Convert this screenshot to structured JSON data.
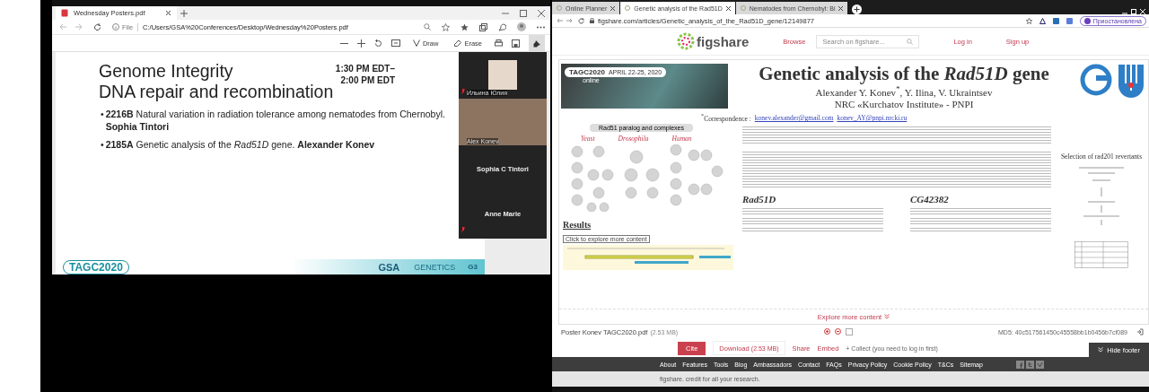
{
  "pdf_viewer": {
    "tab_title": "Wednesday Posters.pdf",
    "address_scheme": "File",
    "address": "C:/Users/GSA%20Conferences/Desktop/Wednesday%20Posters.pdf",
    "tools": [
      {
        "kind": "draw",
        "label": "Draw"
      },
      {
        "kind": "erase",
        "label": "Erase"
      }
    ]
  },
  "slide": {
    "title_lines": [
      "Genome Integrity",
      "DNA repair and recombination"
    ],
    "time_lines": [
      "1:30 PM EDT–",
      "2:00 PM EDT"
    ],
    "items": [
      {
        "marker": "•",
        "text": "**2216B** Natural variation in radiation tolerance among nematodes from Chernobyl. **Sophia Tintori**"
      },
      {
        "marker": "•",
        "text": "**2185A** Genetic analysis of the *Rad51D* gene. **Alexander Konev**"
      }
    ],
    "footer_logos": [
      "TAGC2020",
      "GSA",
      "GENETICS",
      "G3"
    ]
  },
  "video_gallery": [
    {
      "kind": "photo",
      "name": "Ильина Юлия",
      "muted": true
    },
    {
      "kind": "video",
      "name": "Alex Konev",
      "muted": false
    },
    {
      "kind": "name",
      "name": "Sophia C Tintori",
      "muted": false
    },
    {
      "kind": "name",
      "name": "Anne Marie",
      "muted": true
    }
  ],
  "browser": {
    "tabs": [
      {
        "title": "Online Planner",
        "selected": false
      },
      {
        "title": "Genetic analysis of the Rad51D",
        "selected": true
      },
      {
        "title": "Nematodes from Chernobyl: Bi",
        "selected": false
      }
    ],
    "address": "figshare.com/articles/Genetic_analysis_of_the_Rad51D_gene/12149877",
    "profile": "Приостановлена"
  },
  "figshare_header": {
    "logo": "figshare",
    "nav": "Browse",
    "search_placeholder": "Search on figshare...",
    "login": "Log in",
    "signup": "Sign up"
  },
  "poster": {
    "banner": {
      "name": "TAGC2020",
      "sub": "online",
      "dates": "APRIL 22-25, 2020"
    },
    "title": "Genetic analysis of the *Rad51D* gene",
    "authors": "Alexander Y.  Konev$^{*}$, Y. Ilina, V. Ukraintsev",
    "affiliation": "NRC «Kurchatov Institute» - PNPI",
    "correspondence_label": "$^{*}$Correspondence :",
    "emails": [
      "konev.alexander@gmail.com",
      "konev_AY@pnpi.nrcki.ru"
    ],
    "diagram_heading": "Rad51 paralog and complexes",
    "diagram_columns": [
      "Yeast",
      "Drosophila",
      "Human"
    ],
    "results_heading": "Results",
    "explore_hint": "Click to explore more content",
    "gene_headings": [
      "Rad51D",
      "CG42382"
    ],
    "side_heading": "Selection of rad201 revertants",
    "explore_more": "Explore more content"
  },
  "file_bar": {
    "file_name": "Poster Konev TAGC2020.pdf",
    "file_size": "(2.53 MB)",
    "md5": "MD5: 40c517561450c45558bb1b0456b7cf089"
  },
  "actions": {
    "cite": "Cite",
    "download": "Download",
    "download_size": "(2.53 MB)",
    "share": "Share",
    "embed": "Embed",
    "collect": "+ Collect (you need to log in first)",
    "hide_footer": "Hide footer"
  },
  "footer": {
    "links": [
      "About",
      "Features",
      "Tools",
      "Blog",
      "Ambassadors",
      "Contact",
      "FAQs",
      "Privacy Policy",
      "Cookie Policy",
      "T&Cs",
      "Sitemap"
    ],
    "tagline": "figshare. credit for all your research."
  }
}
